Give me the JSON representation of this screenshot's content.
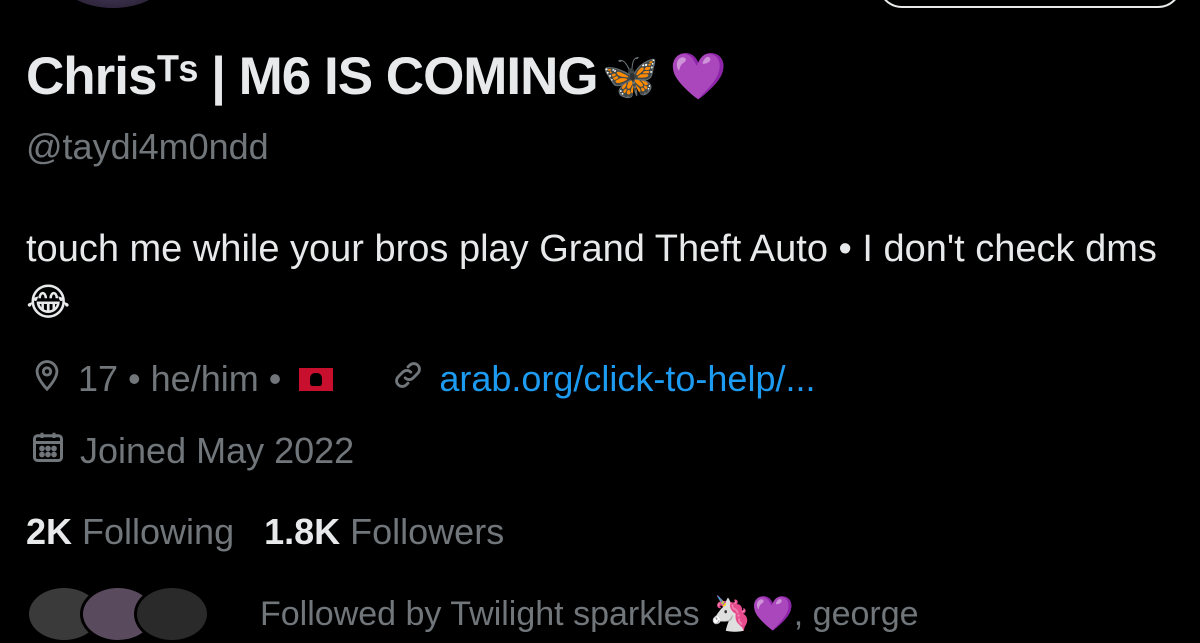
{
  "profile": {
    "display_name": "Chrisᵀˢ | M6 IS COMING",
    "display_emoji": "🦋 💜",
    "handle": "@taydi4m0ndd",
    "bio": "touch me while your bros play Grand Theft Auto • I don't check dms😂",
    "details": "17 • he/him •",
    "flag": "Albania flag",
    "website": "arab.org/click-to-help/...",
    "joined": "Joined May 2022"
  },
  "stats": {
    "following_count": "2K",
    "following_label": "Following",
    "followers_count": "1.8K",
    "followers_label": "Followers"
  },
  "followed_by": {
    "text": "Followed by Twilight sparkles 🦄💜, george"
  },
  "icons": {
    "location": "location-pin-icon",
    "link": "link-icon",
    "calendar": "calendar-icon"
  },
  "colors": {
    "background": "#000000",
    "text": "#e7e9ea",
    "secondary": "#71767b",
    "link": "#1d9bf0"
  }
}
